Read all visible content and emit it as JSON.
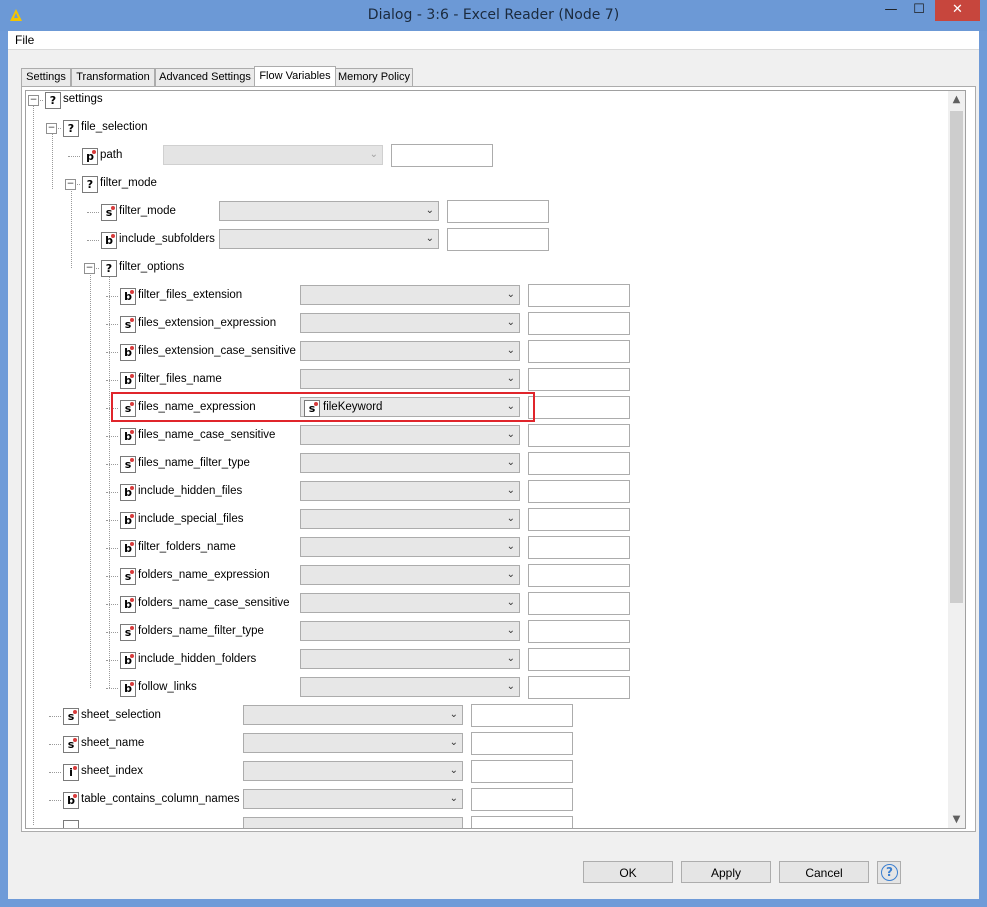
{
  "window": {
    "title": "Dialog - 3:6 - Excel Reader (Node 7)",
    "controls": {
      "minimize": "—",
      "maximize": "☐",
      "close": "✕"
    }
  },
  "menu": {
    "file": "File"
  },
  "tabs": [
    {
      "label": "Settings",
      "active": false
    },
    {
      "label": "Transformation",
      "active": false
    },
    {
      "label": "Advanced Settings",
      "active": false
    },
    {
      "label": "Flow Variables",
      "active": true
    },
    {
      "label": "Memory Policy",
      "active": false
    }
  ],
  "tree": {
    "nodes": [
      {
        "name": "settings",
        "type": "?"
      },
      {
        "name": "file_selection",
        "type": "?"
      },
      {
        "name": "path",
        "type": "p",
        "value": ""
      },
      {
        "name": "filter_mode",
        "type": "?"
      },
      {
        "name": "filter_mode",
        "type": "s",
        "value": ""
      },
      {
        "name": "include_subfolders",
        "type": "b",
        "value": ""
      },
      {
        "name": "filter_options",
        "type": "?"
      },
      {
        "name": "filter_files_extension",
        "type": "b",
        "value": ""
      },
      {
        "name": "files_extension_expression",
        "type": "s",
        "value": ""
      },
      {
        "name": "files_extension_case_sensitive",
        "type": "b",
        "value": ""
      },
      {
        "name": "filter_files_name",
        "type": "b",
        "value": ""
      },
      {
        "name": "files_name_expression",
        "type": "s",
        "value": "fileKeyword"
      },
      {
        "name": "files_name_case_sensitive",
        "type": "b",
        "value": ""
      },
      {
        "name": "files_name_filter_type",
        "type": "s",
        "value": ""
      },
      {
        "name": "include_hidden_files",
        "type": "b",
        "value": ""
      },
      {
        "name": "include_special_files",
        "type": "b",
        "value": ""
      },
      {
        "name": "filter_folders_name",
        "type": "b",
        "value": ""
      },
      {
        "name": "folders_name_expression",
        "type": "s",
        "value": ""
      },
      {
        "name": "folders_name_case_sensitive",
        "type": "b",
        "value": ""
      },
      {
        "name": "folders_name_filter_type",
        "type": "s",
        "value": ""
      },
      {
        "name": "include_hidden_folders",
        "type": "b",
        "value": ""
      },
      {
        "name": "follow_links",
        "type": "b",
        "value": ""
      },
      {
        "name": "sheet_selection",
        "type": "s",
        "value": ""
      },
      {
        "name": "sheet_name",
        "type": "s",
        "value": ""
      },
      {
        "name": "sheet_index",
        "type": "i",
        "value": ""
      },
      {
        "name": "table_contains_column_names",
        "type": "b",
        "value": ""
      }
    ]
  },
  "buttons": {
    "ok": "OK",
    "apply": "Apply",
    "cancel": "Cancel",
    "help": "?"
  },
  "colors": {
    "highlight": "#e0252b",
    "titlebar": "#6c99d6",
    "type_dot": "#d83b3b"
  }
}
